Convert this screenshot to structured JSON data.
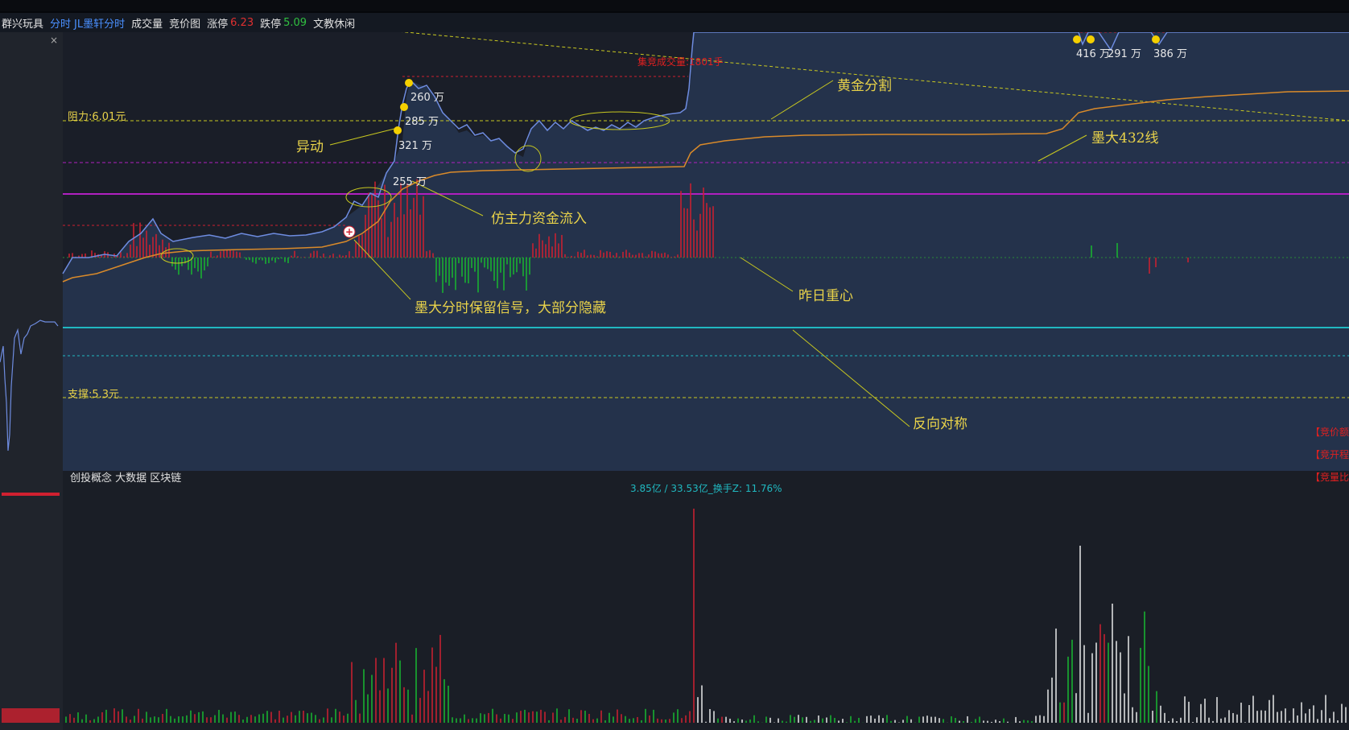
{
  "header": {
    "stock_name": "群兴玩具",
    "tabs": [
      "分时",
      "JL墨轩分时",
      "成交量",
      "竞价图"
    ],
    "limit_up_label": "涨停",
    "limit_up_value": "6.23",
    "limit_down_label": "跌停",
    "limit_down_value": "5.09",
    "industry": "文教休闲"
  },
  "window": {
    "close_glyph": "×"
  },
  "annotations": {
    "resistance": "阻力:6.01元",
    "support": "支撑:5.3元",
    "auction_volume": "集竞成交量:1801手",
    "yidong": "异动",
    "golden_split": "黄金分割",
    "moda_line": "墨大432线",
    "fund_inflow": "仿主力资金流入",
    "signal_note": "墨大分时保留信号，大部分隐藏",
    "yesterday_center": "昨日重心",
    "reverse_symmetry": "反向对称"
  },
  "price_tags": [
    "260 万",
    "285 万",
    "321 万",
    "255 万",
    "416 万",
    "291 万",
    "386 万"
  ],
  "concepts": "创投概念 大数据 区块链",
  "volume_stats": "3.85亿 / 33.53亿_换手Z: 11.76%",
  "right_labels": [
    "【竞价额",
    "【竞开程",
    "【竞量比"
  ],
  "colors": {
    "price_line": "#6e8ce0",
    "avg_line": "#d98a2a",
    "resistance": "#c8c820",
    "purple_line": "#b020c0",
    "cyan_line": "#20b8c0",
    "up": "#d02030",
    "down": "#18b830",
    "annotation": "#e8d24a",
    "marker": "#f5d000"
  }
}
